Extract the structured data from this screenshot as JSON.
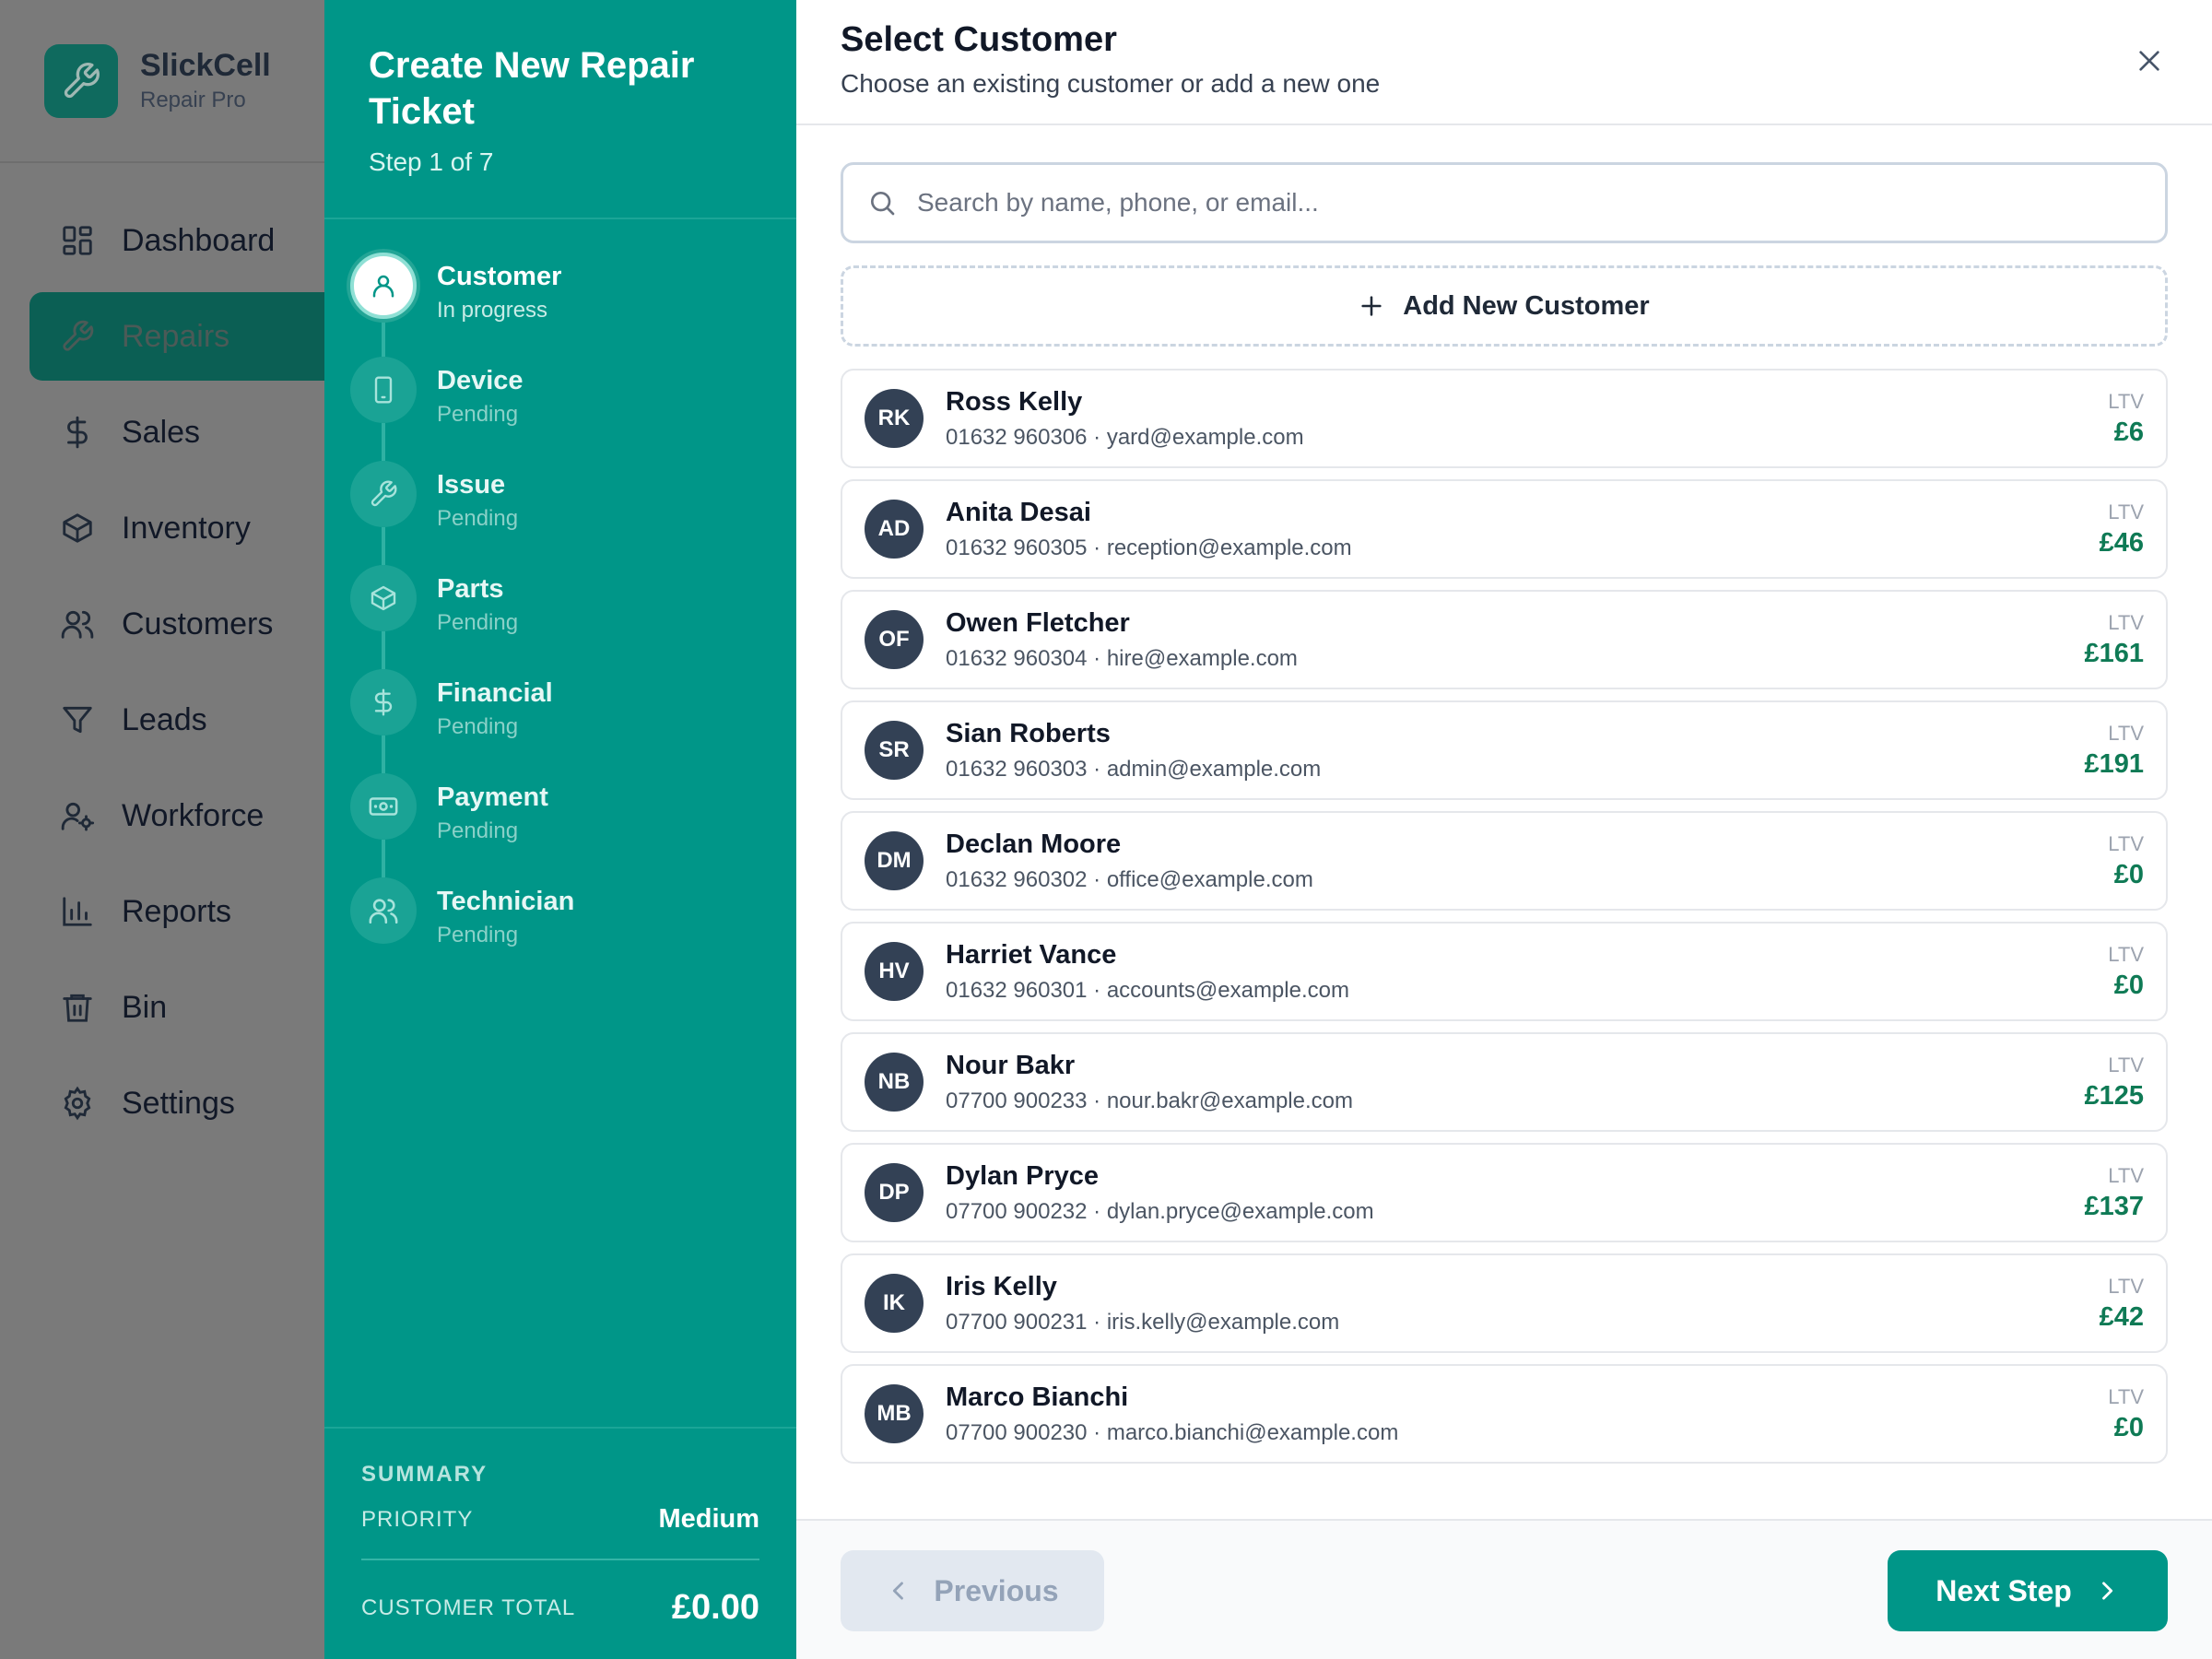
{
  "brand": {
    "name": "SlickCell",
    "subtitle": "Repair Pro"
  },
  "nav": [
    {
      "label": "Dashboard",
      "icon": "dashboard-icon",
      "active": false
    },
    {
      "label": "Repairs",
      "icon": "wrench-icon",
      "active": true
    },
    {
      "label": "Sales",
      "icon": "dollar-icon",
      "active": false
    },
    {
      "label": "Inventory",
      "icon": "box-icon",
      "active": false
    },
    {
      "label": "Customers",
      "icon": "users-icon",
      "active": false
    },
    {
      "label": "Leads",
      "icon": "filter-icon",
      "active": false
    },
    {
      "label": "Workforce",
      "icon": "user-gear-icon",
      "active": false
    },
    {
      "label": "Reports",
      "icon": "bar-chart-icon",
      "active": false
    },
    {
      "label": "Bin",
      "icon": "trash-icon",
      "active": false
    },
    {
      "label": "Settings",
      "icon": "gear-icon",
      "active": false
    }
  ],
  "wizard": {
    "title": "Create New Repair Ticket",
    "step_text": "Step 1 of 7",
    "steps": [
      {
        "name": "Customer",
        "status": "In progress",
        "icon": "user-icon"
      },
      {
        "name": "Device",
        "status": "Pending",
        "icon": "phone-icon"
      },
      {
        "name": "Issue",
        "status": "Pending",
        "icon": "wrench-icon"
      },
      {
        "name": "Parts",
        "status": "Pending",
        "icon": "box-icon"
      },
      {
        "name": "Financial",
        "status": "Pending",
        "icon": "dollar-icon"
      },
      {
        "name": "Payment",
        "status": "Pending",
        "icon": "banknote-icon"
      },
      {
        "name": "Technician",
        "status": "Pending",
        "icon": "users-icon"
      }
    ],
    "summary": {
      "title": "SUMMARY",
      "priority_label": "PRIORITY",
      "priority_value": "Medium",
      "total_label": "CUSTOMER TOTAL",
      "total_value": "£0.00"
    }
  },
  "main": {
    "title": "Select Customer",
    "subtitle": "Choose an existing customer or add a new one",
    "search_placeholder": "Search by name, phone, or email...",
    "add_label": "Add New Customer",
    "ltv_label": "LTV",
    "customers": [
      {
        "initials": "RK",
        "name": "Ross Kelly",
        "meta": "01632 960306 · yard@example.com",
        "ltv": "£6"
      },
      {
        "initials": "AD",
        "name": "Anita Desai",
        "meta": "01632 960305 · reception@example.com",
        "ltv": "£46"
      },
      {
        "initials": "OF",
        "name": "Owen Fletcher",
        "meta": "01632 960304 · hire@example.com",
        "ltv": "£161"
      },
      {
        "initials": "SR",
        "name": "Sian Roberts",
        "meta": "01632 960303 · admin@example.com",
        "ltv": "£191"
      },
      {
        "initials": "DM",
        "name": "Declan Moore",
        "meta": "01632 960302 · office@example.com",
        "ltv": "£0"
      },
      {
        "initials": "HV",
        "name": "Harriet Vance",
        "meta": "01632 960301 · accounts@example.com",
        "ltv": "£0"
      },
      {
        "initials": "NB",
        "name": "Nour Bakr",
        "meta": "07700 900233 · nour.bakr@example.com",
        "ltv": "£125"
      },
      {
        "initials": "DP",
        "name": "Dylan Pryce",
        "meta": "07700 900232 · dylan.pryce@example.com",
        "ltv": "£137"
      },
      {
        "initials": "IK",
        "name": "Iris Kelly",
        "meta": "07700 900231 · iris.kelly@example.com",
        "ltv": "£42"
      },
      {
        "initials": "MB",
        "name": "Marco Bianchi",
        "meta": "07700 900230 · marco.bianchi@example.com",
        "ltv": "£0"
      }
    ],
    "footer": {
      "prev_label": "Previous",
      "next_label": "Next Step"
    }
  },
  "colors": {
    "accent": "#009688",
    "ltv_green": "#0f7a55",
    "avatar": "#334155"
  }
}
